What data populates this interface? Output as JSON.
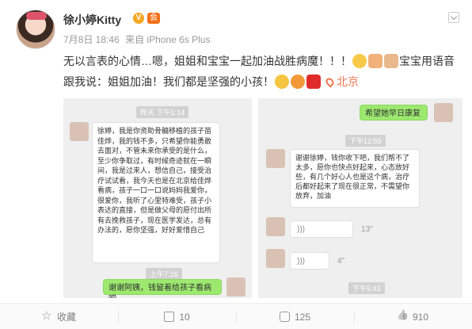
{
  "user": {
    "name": "徐小婷Kitty",
    "verified_badge": "V",
    "member_badge": "会"
  },
  "meta": {
    "date": "7月8日 18:46",
    "source": "来自 iPhone 6s Plus"
  },
  "post": {
    "line1": "无以言表的心情…嗯，姐姐和宝宝一起加油战胜病魔！！！",
    "line1_tail": "宝宝用语音",
    "line2": "跟我说：姐姐加油！我们都是坚强的小孩！",
    "location": "北京"
  },
  "shot1": {
    "timestamp_top": "昨天 下午1:14",
    "message": "徐婷，我是你资助骨髓移植的孩子苗佳烨，我的钱不多，只希望你能勇敢去面对，不管未来你承受的是什么，至少你争取过，有时候奇迹就在一瞬间，我是过来人，想信自己，接受治疗试试看，我今天也是在北京给佳烨看病，孩子一口一口说妈妈我爱你，很爱你，我听了心里特难受，孩子小表达的直接，但是做父母的愿付出所有去挽救孩子，现在医学发达，总有办法的，愿你坚强，好好爱惜自己",
    "timestamp_mid": "上午7:16",
    "reply": "谢谢阿姨，钱留着给孩子看病吧"
  },
  "shot2": {
    "reply": "希望她早日康复",
    "timestamp_mid": "下午12:55",
    "message": "谢谢徐婷，钱你收下吧，我们帮不了太多，愿你也快点好起来，心态放好些，有几个好心人也是这个病，治疗后都好起来了现在很正常，不需望你放弃，加油",
    "voice1_duration": "13\"",
    "voice2_duration": "4\"",
    "timestamp_bottom": "下午5:43"
  },
  "actions": {
    "favorite": "收藏",
    "share": "10",
    "comment": "125",
    "like": "910"
  },
  "colors": {
    "accent": "#eb7350",
    "muted": "#808080",
    "wechat_green": "#9de96f"
  }
}
